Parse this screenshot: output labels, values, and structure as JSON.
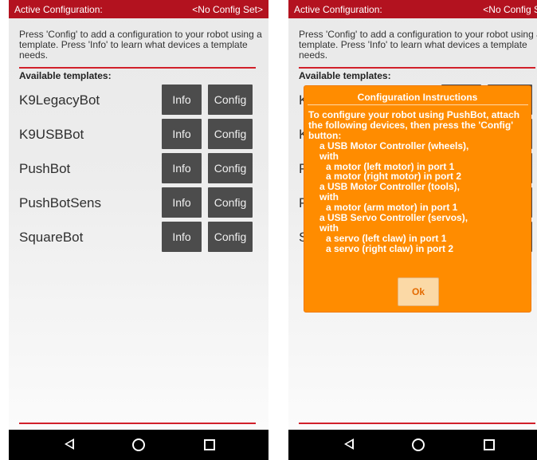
{
  "left_screen": {
    "header": {
      "title": "Active Configuration:",
      "status": "<No Config Set>"
    },
    "instructions": "Press 'Config' to add a configuration to your robot using a template. Press 'Info' to learn what devices a template needs.",
    "available_label": "Available templates:",
    "templates": [
      {
        "name": "K9LegacyBot",
        "info_label": "Info",
        "config_label": "Config"
      },
      {
        "name": "K9USBBot",
        "info_label": "Info",
        "config_label": "Config"
      },
      {
        "name": "PushBot",
        "info_label": "Info",
        "config_label": "Config"
      },
      {
        "name": "PushBotSens",
        "info_label": "Info",
        "config_label": "Config"
      },
      {
        "name": "SquareBot",
        "info_label": "Info",
        "config_label": "Config"
      }
    ]
  },
  "right_screen": {
    "header": {
      "title": "Active Configuration:",
      "status": "<No Config Set>"
    },
    "instructions": "Press 'Config' to add a configuration to your robot using a template. Press 'Info' to learn what devices a template needs.",
    "available_label": "Available templates:",
    "dialog": {
      "title": "Configuration Instructions",
      "intro": "To configure your robot using PushBot, attach the following devices, then press the 'Config' button:",
      "lines": [
        {
          "text": "a USB Motor Controller (wheels),",
          "level": 1
        },
        {
          "text": "with",
          "level": 1
        },
        {
          "text": "a motor (left motor) in port 1",
          "level": 2
        },
        {
          "text": "a motor (right motor) in port 2",
          "level": 2
        },
        {
          "text": "a USB Motor Controller (tools),",
          "level": 1
        },
        {
          "text": "with",
          "level": 1
        },
        {
          "text": "a motor (arm motor) in port 1",
          "level": 2
        },
        {
          "text": "a USB Servo Controller (servos),",
          "level": 1
        },
        {
          "text": "with",
          "level": 1
        },
        {
          "text": "a servo (left claw) in port 1",
          "level": 2
        },
        {
          "text": "a servo (right claw) in port 2",
          "level": 2
        }
      ],
      "ok_label": "Ok"
    }
  },
  "navbar": {
    "icons": [
      "back-icon",
      "home-icon",
      "recent-apps-icon"
    ]
  },
  "colors": {
    "header_red": "#b3121f",
    "rule_red": "#d1202a",
    "button_gray": "#4c4c4c",
    "dialog_orange": "#ff8c00"
  }
}
